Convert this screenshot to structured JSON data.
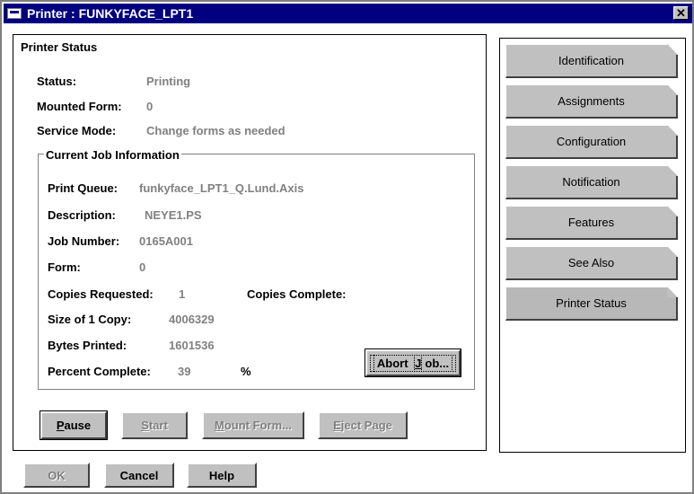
{
  "window": {
    "title": "Printer : FUNKYFACE_LPT1",
    "close_symbol": "✕"
  },
  "status_panel": {
    "title": "Printer Status",
    "status_label": "Status:",
    "status_value": "Printing",
    "mounted_form_label": "Mounted Form:",
    "mounted_form_value": "0",
    "service_mode_label": "Service Mode:",
    "service_mode_value": "Change forms as needed"
  },
  "job_info": {
    "title": "Current Job Information",
    "print_queue_label": "Print Queue:",
    "print_queue_value": "funkyface_LPT1_Q.Lund.Axis",
    "description_label": "Description:",
    "description_value": "NEYE1.PS",
    "job_number_label": "Job Number:",
    "job_number_value": "0165A001",
    "form_label": "Form:",
    "form_value": "0",
    "copies_requested_label": "Copies Requested:",
    "copies_requested_value": "1",
    "copies_complete_label": "Copies Complete:",
    "size_label": "Size of 1 Copy:",
    "size_value": "4006329",
    "bytes_printed_label": "Bytes Printed:",
    "bytes_printed_value": "1601536",
    "percent_label": "Percent Complete:",
    "percent_value": "39",
    "percent_unit": "%",
    "abort_button": {
      "pre": "Abort ",
      "key": "J",
      "post": "ob..."
    }
  },
  "actions": {
    "pause": {
      "key": "P",
      "rest": "ause"
    },
    "start": {
      "key": "S",
      "rest": "tart"
    },
    "mount_form": {
      "key": "M",
      "rest": "ount Form..."
    },
    "eject_page": {
      "key": "E",
      "rest": "ject Page"
    }
  },
  "tabs": [
    {
      "label": "Identification"
    },
    {
      "label": "Assignments"
    },
    {
      "label": "Configuration"
    },
    {
      "label": "Notification"
    },
    {
      "label": "Features"
    },
    {
      "label": "See Also"
    },
    {
      "label": "Printer Status"
    }
  ],
  "footer": {
    "ok": "OK",
    "cancel": "Cancel",
    "help": "Help"
  }
}
